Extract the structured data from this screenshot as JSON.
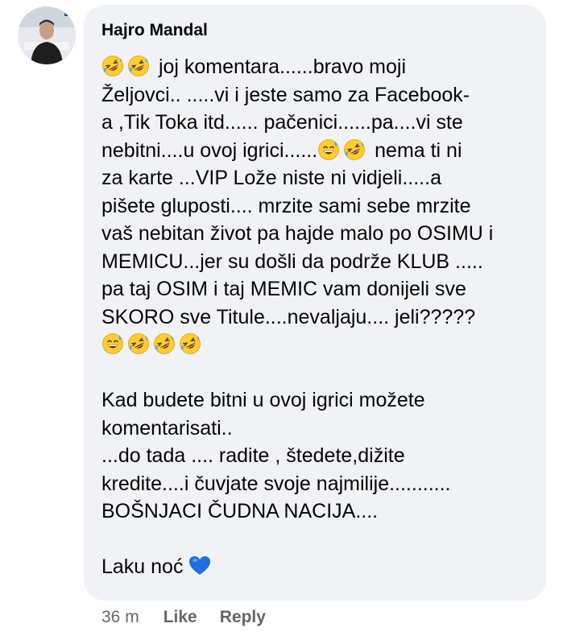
{
  "comment": {
    "author": "Hajro Mandal",
    "avatar_icon": "user-avatar-photo",
    "lines": [
      {
        "emoji_before": [
          "rofl-emoji",
          "rofl-emoji"
        ],
        "text": " joj komentara......bravo moji"
      },
      {
        "text": "Željovci.. .....vi i jeste samo za Facebook-"
      },
      {
        "text": "a ,Tik Toka itd...... pačenici......pa....vi ste"
      },
      {
        "text": "nebitni....u ovoj igrici......",
        "emoji_after": [
          "sweat-smile-emoji",
          "rofl-emoji"
        ],
        "text_after": " nema ti ni"
      },
      {
        "text": "za karte ...VIP Lože niste ni vidjeli.....a"
      },
      {
        "text": "pišete gluposti.... mrzite sami sebe mrzite"
      },
      {
        "text": "vaš nebitan život pa hajde malo po OSIMU i"
      },
      {
        "text": "MEMICU...jer su došli da podrže KLUB ....."
      },
      {
        "text": "pa taj OSIM i taj MEMIC vam donijeli sve"
      },
      {
        "text": "SKORO sve Titule....nevaljaju.... jeli?????"
      },
      {
        "emoji_before": [
          "sweat-smile-emoji",
          "rofl-emoji",
          "rofl-emoji",
          "rofl-emoji"
        ],
        "text": ""
      },
      {
        "text": ""
      },
      {
        "text": "Kad budete bitni u ovoj igrici možete"
      },
      {
        "text": "komentarisati.."
      },
      {
        "text": "...do tada .... radite , štedete,dižite"
      },
      {
        "text": "kredite....i čuvjate svoje najmilije..........."
      },
      {
        "text": "BOŠNJACI ČUDNA NACIJA...."
      },
      {
        "text": ""
      },
      {
        "text": "Laku noć ",
        "emoji_after": [
          "blue-heart-emoji"
        ]
      }
    ],
    "time": "36 m",
    "like_label": "Like",
    "reply_label": "Reply"
  },
  "colors": {
    "bubble": "#f0f2f5",
    "text": "#050505",
    "meta": "#65676b",
    "emoji_face": "#ffcc33",
    "heart": "#1f6fe0"
  }
}
